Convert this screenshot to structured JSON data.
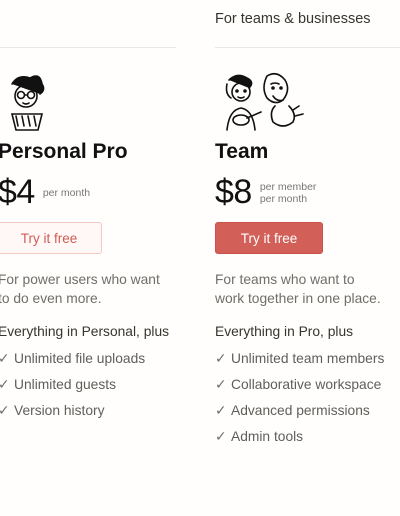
{
  "header": {
    "teams_label": "For teams & businesses"
  },
  "personal": {
    "name": "Personal Pro",
    "price": "$4",
    "price_suffix": [
      "per month"
    ],
    "cta": "Try it free",
    "description": [
      "For power users who want",
      "to do even more."
    ],
    "features_heading": "Everything in Personal, plus",
    "features": [
      "Unlimited file uploads",
      "Unlimited guests",
      "Version history"
    ]
  },
  "team": {
    "name": "Team",
    "price": "$8",
    "price_suffix": [
      "per member",
      "per month"
    ],
    "cta": "Try it free",
    "description": [
      "For teams who want to",
      "work together in one place."
    ],
    "features_heading": "Everything in Pro, plus",
    "features": [
      "Unlimited team members",
      "Collaborative workspace",
      "Advanced permissions",
      "Admin tools"
    ]
  },
  "icons": {
    "check": "✓"
  },
  "colors": {
    "accent": "#d25f58",
    "accent_text": "#cf5c54"
  }
}
